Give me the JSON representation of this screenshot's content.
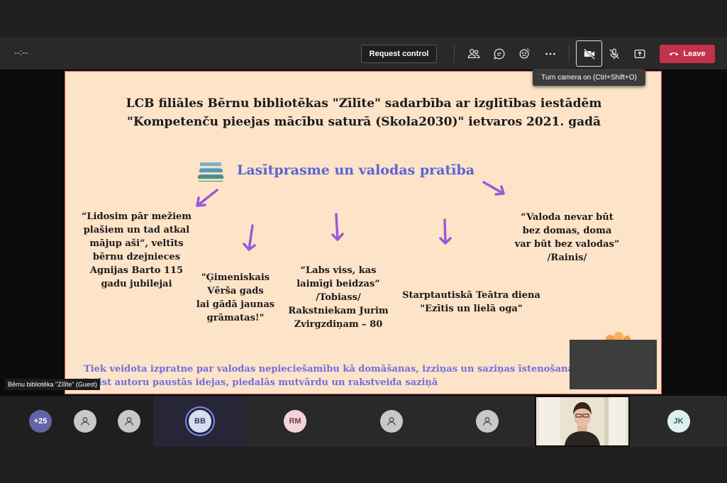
{
  "toolbar": {
    "timer": "--:--",
    "request_control_label": "Request control",
    "leave_label": "Leave",
    "icons": [
      "people-icon",
      "chat-icon",
      "reactions-icon",
      "more-options-icon",
      "camera-off-icon",
      "mic-off-icon",
      "share-icon",
      "phone-icon"
    ]
  },
  "tooltip": {
    "text": "Turn camera on (Ctrl+Shift+O)"
  },
  "slide": {
    "title_line1": "LCB filiāles Bērnu bibliotēkas \"Zīlīte\" sadarbība ar izglītības iestādēm",
    "title_line2": "\"Kompetenču pieejas mācību saturā (Skola2030)\" ietvaros 2021. gadā",
    "subtitle": "Lasītprasme un valodas pratība",
    "item1": [
      "“Lidosim pār mežiem",
      "plašiem un tad atkal",
      "mājup aši”, veltīts",
      "bērnu dzejnieces",
      "Agnijas Barto 115",
      "gadu jubilejai"
    ],
    "item2": [
      "\"Ģimeniskais",
      "Vērša gads",
      "lai gādā jaunas",
      "grāmatas!\""
    ],
    "item3": [
      "“Labs viss, kas",
      "laimīgi beidzas”",
      "/Tobiass/",
      "Rakstniekam Jurim",
      "Zvirgzdiņam – 80"
    ],
    "item4": [
      "Starptautiskā Teātra diena",
      "\"Ezītis un lielā oga\""
    ],
    "item5": [
      "“Valoda nevar būt",
      "bez domas, doma",
      "var būt bez valodas”",
      "/Rainis/"
    ],
    "bottom_line1": "Tiek veidota izpratne par valodas nepieciešamību kā domāšanas, izziņas un saziņas īstenošanai.",
    "bottom_line2": "Izzīst autoru paustās idejas, piedalās mutvārdu un rakstveida saziņā",
    "accent_color": "#5b63d6",
    "background_color": "#fde3c8"
  },
  "stage": {
    "guest_label": "Bērnu bibliotēka \"Zīlīte\" (Guest)"
  },
  "participants": {
    "overflow_count": "+25",
    "bb_initials": "BB",
    "rm_initials": "RM",
    "jk_initials": "JK"
  }
}
